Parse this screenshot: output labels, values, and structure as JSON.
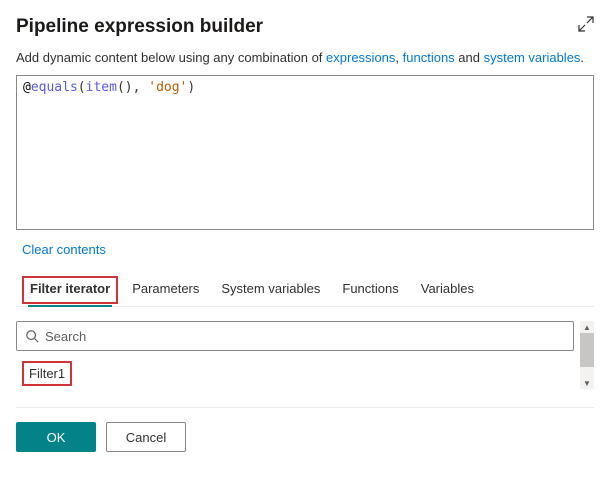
{
  "header": {
    "title": "Pipeline expression builder"
  },
  "subtitle": {
    "prefix": "Add dynamic content below using any combination of ",
    "link1": "expressions",
    "sep1": ", ",
    "link2": "functions",
    "sep2": " and ",
    "link3": "system variables",
    "suffix": "."
  },
  "expression": {
    "at": "@",
    "equals": "equals",
    "paren_open": "(",
    "item": "item",
    "parens_empty": "()",
    "comma": ", ",
    "string": "'dog'",
    "paren_close": ")"
  },
  "clear_label": "Clear contents",
  "tabs": {
    "filter_iterator": "Filter iterator",
    "parameters": "Parameters",
    "system_variables": "System variables",
    "functions": "Functions",
    "variables": "Variables"
  },
  "search": {
    "placeholder": "Search"
  },
  "results": {
    "item1": "Filter1"
  },
  "buttons": {
    "ok": "OK",
    "cancel": "Cancel"
  }
}
